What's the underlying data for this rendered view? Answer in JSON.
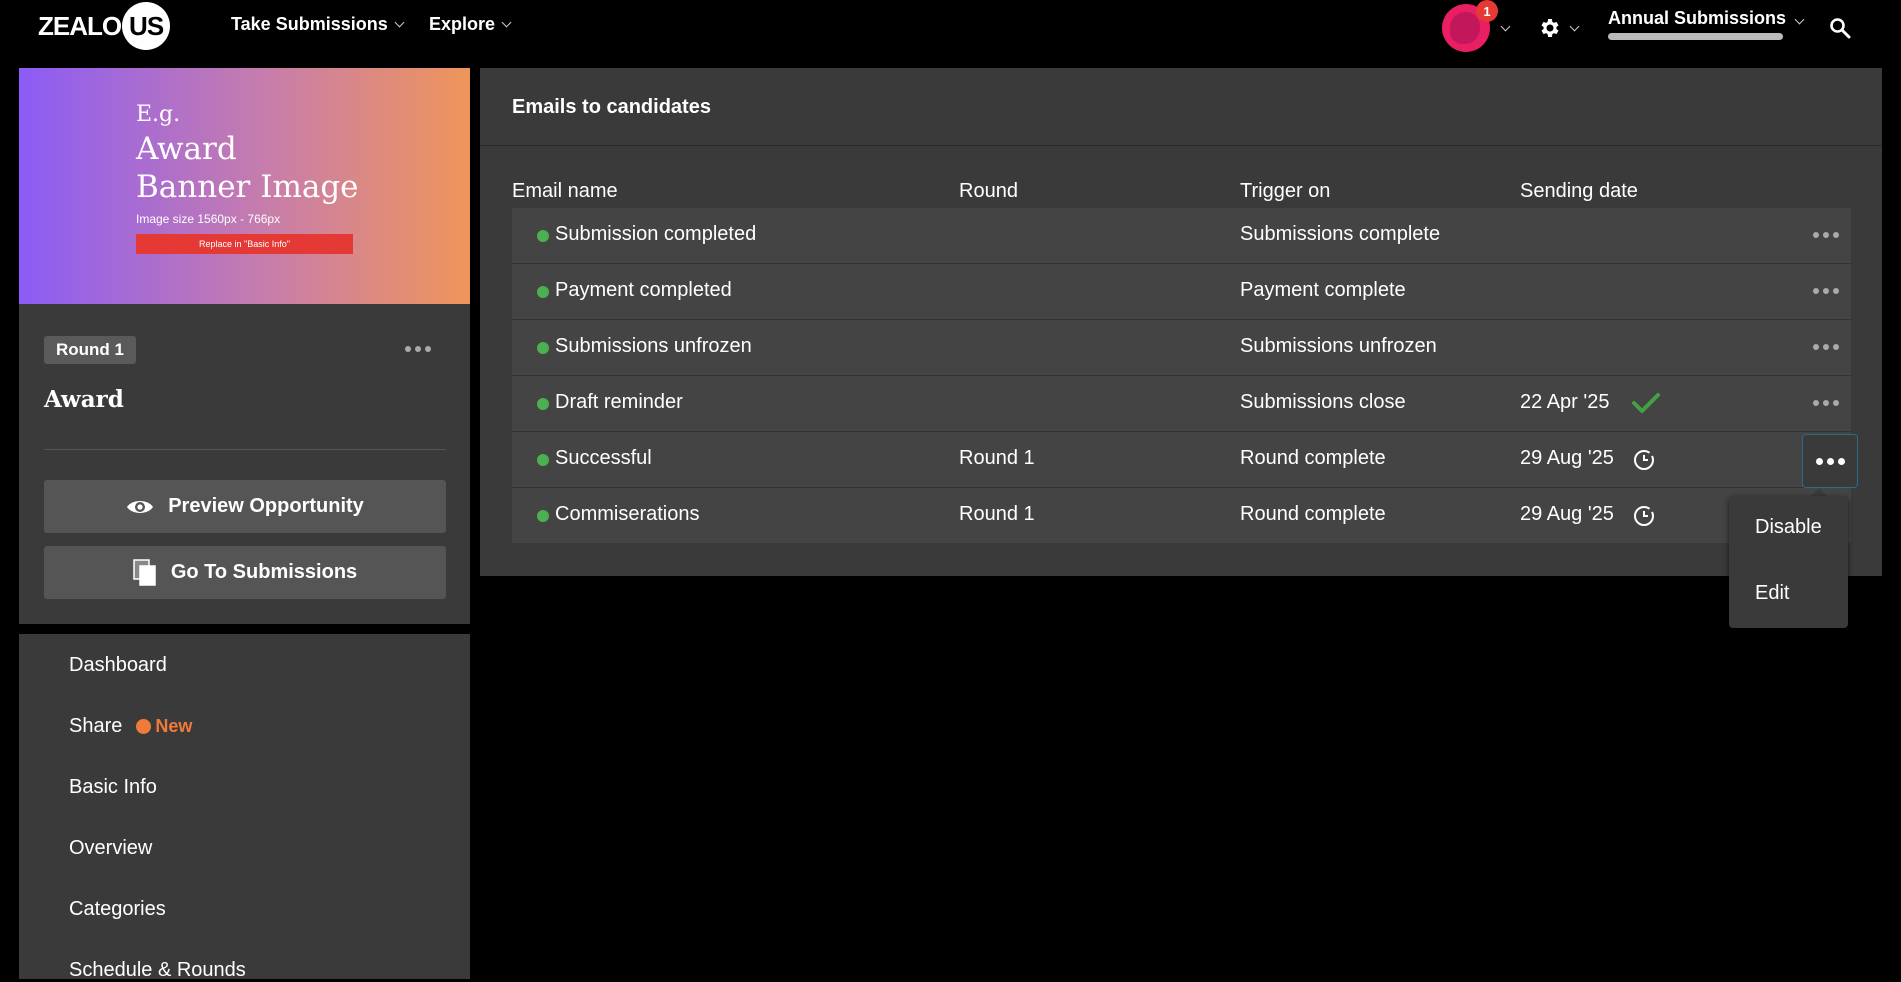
{
  "nav": {
    "logo_left": "ZEALO",
    "logo_right": "US",
    "take_submissions": "Take Submissions",
    "explore": "Explore",
    "notifications_count": "1",
    "workspace_label": "Annual Submissions"
  },
  "banner": {
    "eg": "E.g.",
    "title_line1": "Award",
    "title_line2": "Banner Image",
    "size_text": "Image size 1560px - 766px",
    "replace_text": "Replace in \"Basic Info\""
  },
  "card": {
    "round_pill": "Round 1",
    "title": "Award",
    "preview_button": "Preview Opportunity",
    "submissions_button": "Go To Submissions"
  },
  "menu": {
    "items": [
      {
        "label": "Dashboard"
      },
      {
        "label": "Share",
        "badge": "New"
      },
      {
        "label": "Basic Info"
      },
      {
        "label": "Overview"
      },
      {
        "label": "Categories"
      },
      {
        "label": "Schedule & Rounds"
      }
    ]
  },
  "emails": {
    "title": "Emails to candidates",
    "columns": [
      "Email name",
      "Round",
      "Trigger on",
      "Sending date"
    ],
    "rows": [
      {
        "name": "Submission completed",
        "round": "",
        "trigger": "Submissions complete",
        "date": "",
        "status": ""
      },
      {
        "name": "Payment completed",
        "round": "",
        "trigger": "Payment complete",
        "date": "",
        "status": ""
      },
      {
        "name": "Submissions unfrozen",
        "round": "",
        "trigger": "Submissions unfrozen",
        "date": "",
        "status": ""
      },
      {
        "name": "Draft reminder",
        "round": "",
        "trigger": "Submissions close",
        "date": "22 Apr '25",
        "status": "sent"
      },
      {
        "name": "Successful",
        "round": "Round 1",
        "trigger": "Round complete",
        "date": "29 Aug '25",
        "status": "scheduled"
      },
      {
        "name": "Commiserations",
        "round": "Round 1",
        "trigger": "Round complete",
        "date": "29 Aug '25",
        "status": "scheduled"
      }
    ]
  },
  "dropdown": {
    "disable": "Disable",
    "edit": "Edit"
  },
  "colors": {
    "status_dot": "#4caf50",
    "new_badge": "#f07a3a",
    "check": "#43a047"
  }
}
